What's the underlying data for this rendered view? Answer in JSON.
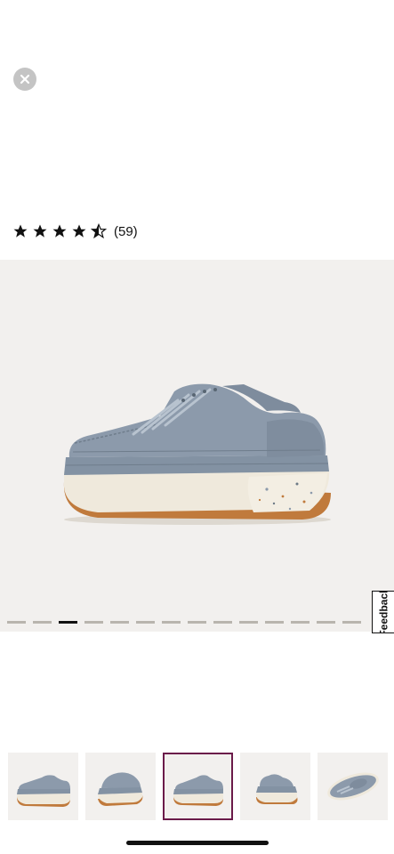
{
  "close": {
    "icon": "close-icon"
  },
  "rating": {
    "stars": 4.5,
    "count_text": "(59)"
  },
  "gallery": {
    "slide_count": 14,
    "active_index": 2
  },
  "feedback": {
    "label": "Feedback"
  },
  "thumbnails": [
    {
      "view": "side",
      "selected": false
    },
    {
      "view": "front-three-quarter",
      "selected": false
    },
    {
      "view": "side",
      "selected": true
    },
    {
      "view": "back-three-quarter",
      "selected": false
    },
    {
      "view": "top",
      "selected": false
    }
  ],
  "colors": {
    "selected_border": "#6b1b4a",
    "shoe": "#8c9aab",
    "sole": "#efe9dc",
    "gum": "#c07a3c"
  }
}
